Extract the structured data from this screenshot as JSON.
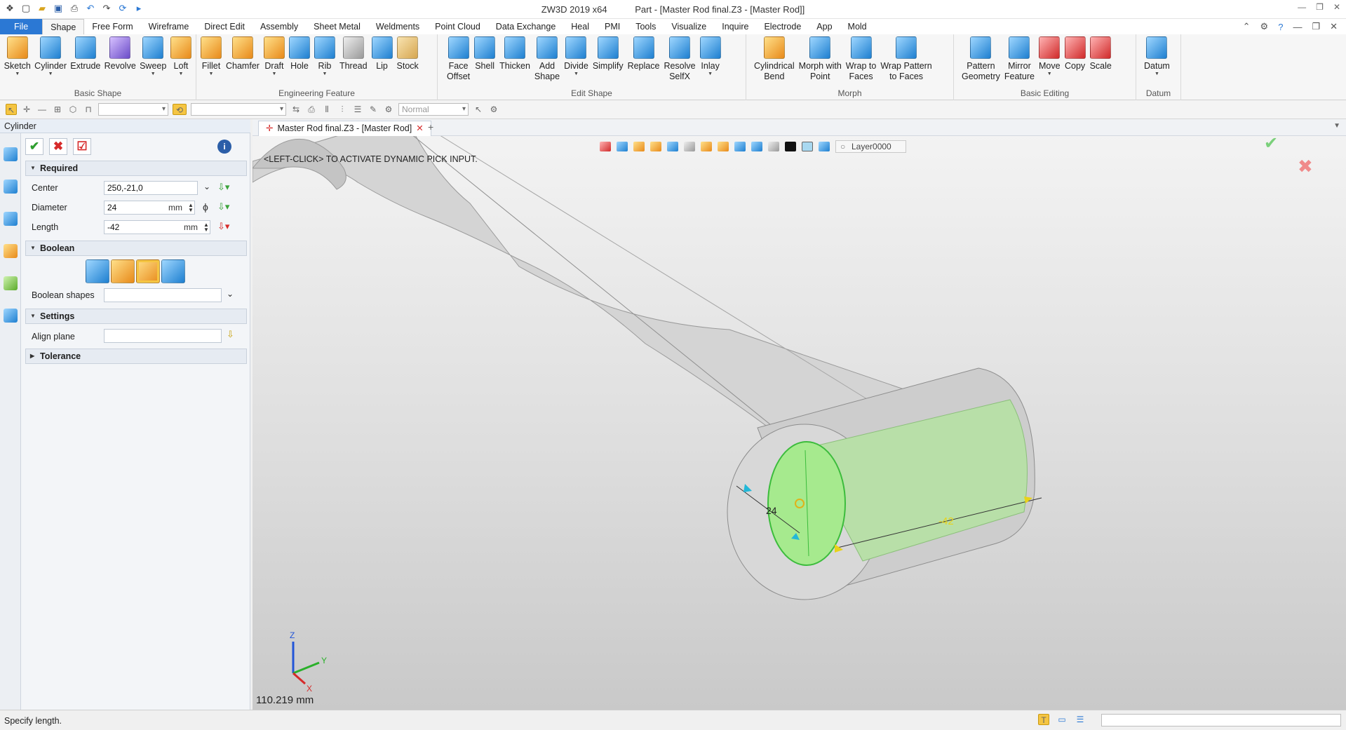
{
  "titlebar": {
    "app": "ZW3D 2019  x64",
    "document": "Part - [Master Rod final.Z3 - [Master Rod]]"
  },
  "menu": [
    "File",
    "Shape",
    "Free Form",
    "Wireframe",
    "Direct Edit",
    "Assembly",
    "Sheet Metal",
    "Weldments",
    "Point Cloud",
    "Data Exchange",
    "Heal",
    "PMI",
    "Tools",
    "Visualize",
    "Inquire",
    "Electrode",
    "App",
    "Mold"
  ],
  "ribbon": {
    "basic_shape": {
      "label": "Basic Shape",
      "items": [
        "Sketch",
        "Cylinder",
        "Extrude",
        "Revolve",
        "Sweep",
        "Loft"
      ]
    },
    "engineering": {
      "label": "Engineering Feature",
      "items": [
        "Fillet",
        "Chamfer",
        "Draft",
        "Hole",
        "Rib",
        "Thread",
        "Lip",
        "Stock"
      ]
    },
    "edit_shape": {
      "label": "Edit Shape",
      "items": [
        "Face\nOffset",
        "Shell",
        "Thicken",
        "Add\nShape",
        "Divide",
        "Simplify",
        "Replace",
        "Resolve\nSelfX",
        "Inlay"
      ]
    },
    "morph": {
      "label": "Morph",
      "items": [
        "Cylindrical\nBend",
        "Morph with\nPoint",
        "Wrap to\nFaces",
        "Wrap Pattern\nto Faces"
      ]
    },
    "basic_editing": {
      "label": "Basic Editing",
      "items": [
        "Pattern\nGeometry",
        "Mirror\nFeature",
        "Move",
        "Copy",
        "Scale"
      ]
    },
    "datum": {
      "label": "Datum",
      "items": [
        "Datum"
      ]
    }
  },
  "toolbar2": {
    "render_mode": "Normal"
  },
  "panel": {
    "title": "Cylinder",
    "required_label": "Required",
    "center_label": "Center",
    "center_value": "250,-21,0",
    "diameter_label": "Diameter",
    "diameter_value": "24",
    "diameter_unit": "mm",
    "diameter_symbol": "ϕ",
    "length_label": "Length",
    "length_value": "-42",
    "length_unit": "mm",
    "boolean_label": "Boolean",
    "boolean_shapes_label": "Boolean shapes",
    "boolean_shapes_value": "",
    "settings_label": "Settings",
    "align_plane_label": "Align plane",
    "align_plane_value": "",
    "tolerance_label": "Tolerance"
  },
  "viewport": {
    "tab": "Master Rod final.Z3 - [Master Rod]",
    "hint": "<LEFT-CLICK> TO ACTIVATE DYNAMIC PICK INPUT.",
    "layer": "Layer0000",
    "dim_diameter": "24",
    "dim_length": "-42",
    "measure": "110.219 mm",
    "axis_x": "X",
    "axis_y": "Y",
    "axis_z": "Z"
  },
  "status": {
    "text": "Specify length."
  },
  "colors": {
    "file_tab": "#2b78d4",
    "preview_green": "#9ee28a",
    "dim_yellow": "#e8d21a",
    "dim_cyan": "#22b8d8"
  }
}
